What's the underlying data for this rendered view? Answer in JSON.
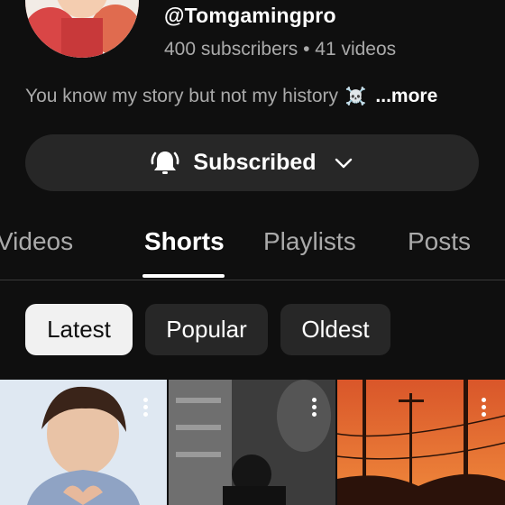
{
  "channel": {
    "handle": "@Tomgamingpro",
    "stats": "400 subscribers • 41 videos",
    "description": "You know my story but not my history",
    "description_emoji": "☠️",
    "more_label": "...more"
  },
  "subscribe_button": {
    "label": "Subscribed"
  },
  "tabs": [
    {
      "label": "Videos"
    },
    {
      "label": "Shorts"
    },
    {
      "label": "Playlists"
    },
    {
      "label": "Posts"
    }
  ],
  "active_tab": "Shorts",
  "filters": [
    {
      "label": "Latest"
    },
    {
      "label": "Popular"
    },
    {
      "label": "Oldest"
    }
  ],
  "selected_filter": "Latest",
  "colors": {
    "background": "#0f0f0f",
    "chip": "#272727",
    "chip_selected": "#f1f1f1",
    "secondary_text": "#aaaaaa"
  },
  "icons": [
    "bell-ring-icon",
    "chevron-down-icon",
    "more-vert-icon"
  ]
}
